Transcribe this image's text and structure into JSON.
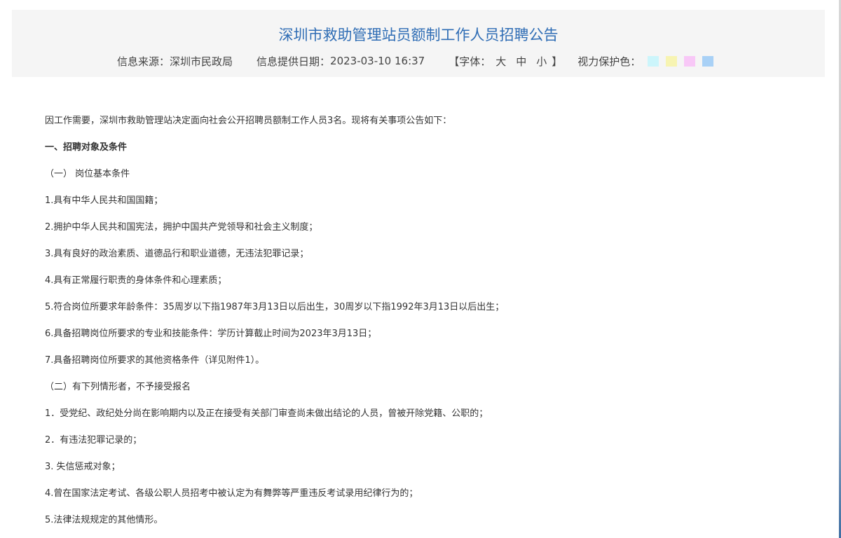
{
  "header": {
    "title": "深圳市救助管理站员额制工作人员招聘公告",
    "source_label": "信息来源：",
    "source_value": "深圳市民政局",
    "date_label": "信息提供日期：",
    "date_value": "2023-03-10 16:37",
    "font_bracket_open": "【字体：",
    "font_sizes": [
      "大",
      "中",
      "小"
    ],
    "font_bracket_close": "】",
    "eye_care_label": "视力保护色：",
    "eye_care_colors": [
      "#ccf5fb",
      "#f7f4b2",
      "#f8c8f7",
      "#a9d1f6"
    ]
  },
  "article": {
    "paragraphs": [
      "因工作需要，深圳市救助管理站决定面向社会公开招聘员额制工作人员3名。现将有关事项公告如下：",
      "一、招聘对象及条件",
      "（一） 岗位基本条件",
      "1.具有中华人民共和国国籍；",
      "2.拥护中华人民共和国宪法，拥护中国共产党领导和社会主义制度；",
      "3.具有良好的政治素质、道德品行和职业道德，无违法犯罪记录；",
      "4.具有正常履行职责的身体条件和心理素质；",
      "5.符合岗位所要求年龄条件：35周岁以下指1987年3月13日以后出生，30周岁以下指1992年3月13日以后出生；",
      "6.具备招聘岗位所要求的专业和技能条件：学历计算截止时间为2023年3月13日；",
      "7.具备招聘岗位所要求的其他资格条件（详见附件1）。",
      "（二）有下列情形者，不予接受报名",
      "1．受党纪、政纪处分尚在影响期内以及正在接受有关部门审查尚未做出结论的人员，曾被开除党籍、公职的；",
      "2．有违法犯罪记录的；",
      "3. 失信惩戒对象；",
      "4.曾在国家法定考试、各级公职人员招考中被认定为有舞弊等严重违反考试录用纪律行为的；",
      "5.法律法规规定的其他情形。"
    ]
  }
}
